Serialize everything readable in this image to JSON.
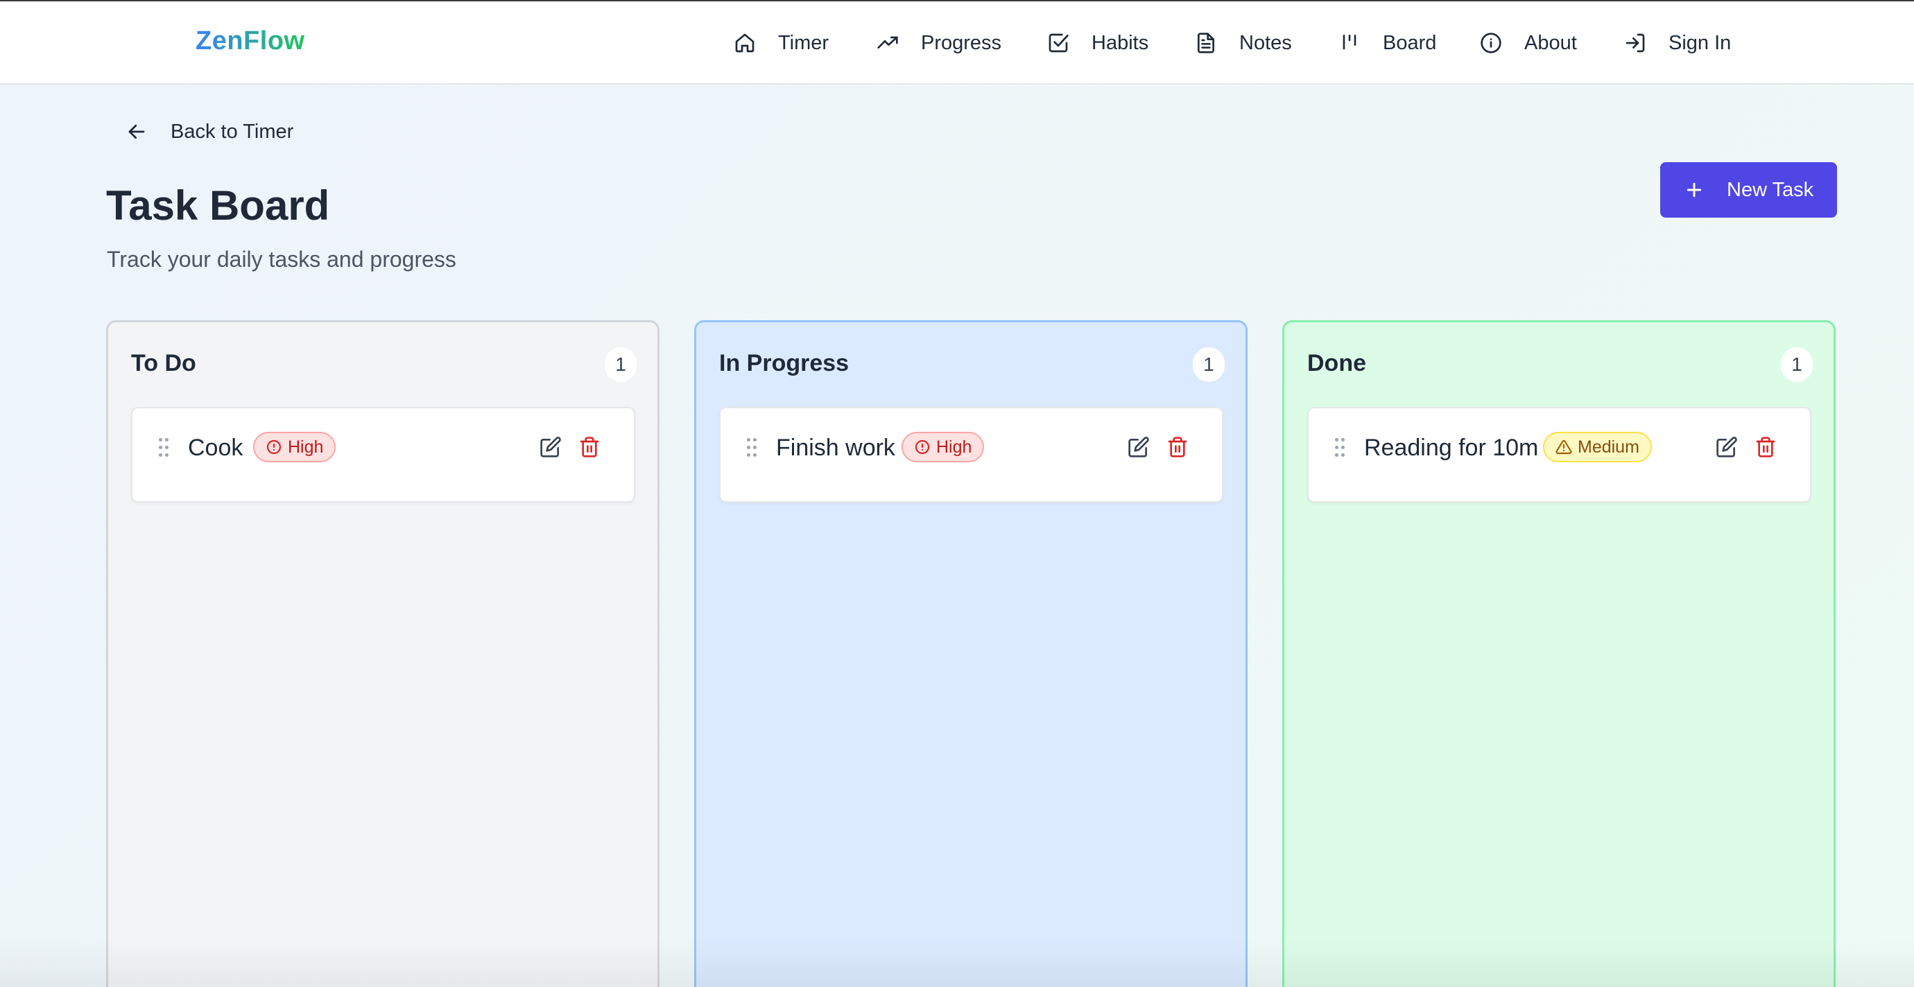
{
  "app": {
    "logo": "ZenFlow"
  },
  "nav": {
    "items": [
      {
        "label": "Timer",
        "icon": "home-icon"
      },
      {
        "label": "Progress",
        "icon": "trending-up-icon"
      },
      {
        "label": "Habits",
        "icon": "check-square-icon"
      },
      {
        "label": "Notes",
        "icon": "file-text-icon"
      },
      {
        "label": "Board",
        "icon": "kanban-icon"
      },
      {
        "label": "About",
        "icon": "info-icon"
      },
      {
        "label": "Sign In",
        "icon": "sign-in-icon"
      }
    ]
  },
  "back": {
    "label": "Back to Timer"
  },
  "page": {
    "title": "Task Board",
    "subtitle": "Track your daily tasks and progress",
    "new_task_label": "New Task"
  },
  "columns": [
    {
      "title": "To Do",
      "count": "1",
      "tasks": [
        {
          "title": "Cook",
          "priority": "High"
        }
      ]
    },
    {
      "title": "In Progress",
      "count": "1",
      "tasks": [
        {
          "title": "Finish work",
          "priority": "High"
        }
      ]
    },
    {
      "title": "Done",
      "count": "1",
      "tasks": [
        {
          "title": "Reading for 10m",
          "priority": "Medium"
        }
      ]
    }
  ],
  "colors": {
    "accent": "#4f46e5",
    "todo_bg": "#f3f4f6",
    "progress_bg": "#dbeafe",
    "done_bg": "#dcfce7",
    "high": "#dc2626",
    "medium": "#a16207"
  }
}
